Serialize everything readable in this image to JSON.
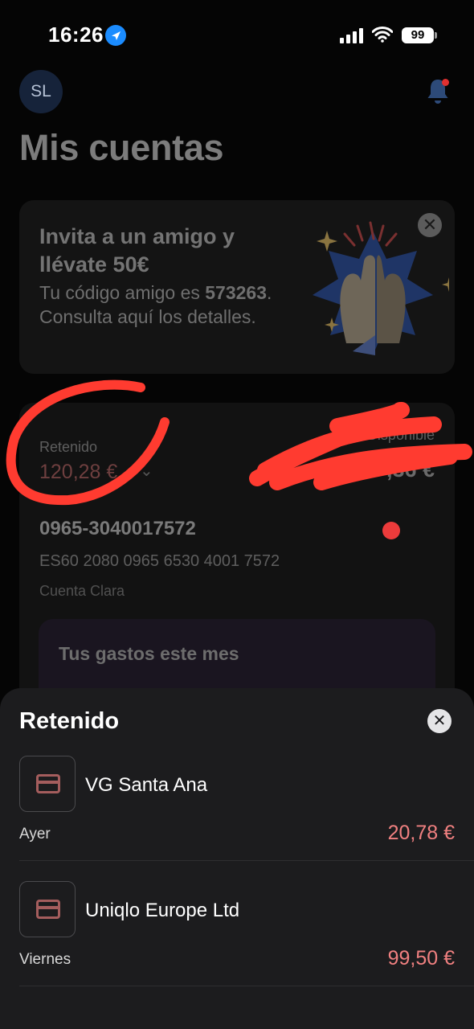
{
  "status_bar": {
    "time": "16:26",
    "battery": "99"
  },
  "header": {
    "avatar_initials": "SL",
    "title": "Mis cuentas"
  },
  "promo": {
    "title": "Invita a un amigo y llévate 50€",
    "text_before": "Tu código amigo es ",
    "code": "573263",
    "text_after": ". Consulta aquí los detalles.",
    "close": "✕"
  },
  "account": {
    "retained_label": "Retenido",
    "retained_amount": "120,28 €",
    "available_label": "Disponible",
    "available_amount": ",36 €",
    "number": "0965-3040017572",
    "iban": "ES60 2080 0965 6530 4001 7572",
    "type": "Cuenta Clara",
    "spend_title": "Tus gastos este mes"
  },
  "sheet": {
    "title": "Retenido",
    "close": "✕",
    "transactions": [
      {
        "name": "VG Santa Ana",
        "date": "Ayer",
        "amount": "20,78 €"
      },
      {
        "name": "Uniqlo Europe Ltd",
        "date": "Viernes",
        "amount": "99,50 €"
      }
    ]
  },
  "colors": {
    "accent": "#f08080",
    "background": "#050505",
    "sheet": "#1c1c1e",
    "annotation": "#ff3b30"
  }
}
